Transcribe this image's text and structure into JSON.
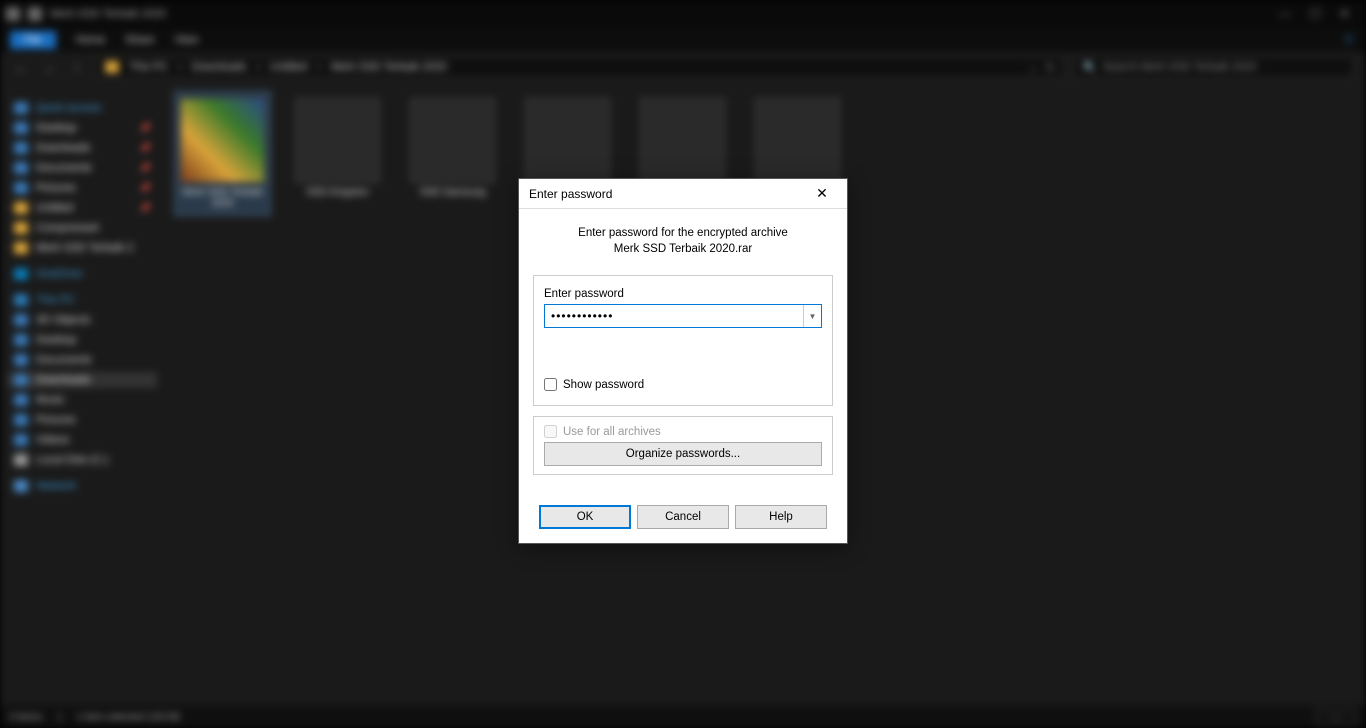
{
  "titlebar": {
    "title": "Merk SSD Terbaik 2020"
  },
  "ribbon": {
    "file": "File",
    "tabs": [
      "Home",
      "Share",
      "View"
    ]
  },
  "breadcrumb": {
    "parts": [
      "This PC",
      "Downloads",
      "Untitled",
      "Merk SSD Terbaik 2020"
    ]
  },
  "search": {
    "placeholder": "Search Merk SSD Terbaik 2020"
  },
  "sidebar": {
    "quick": "Quick access",
    "qitems": [
      "Desktop",
      "Downloads",
      "Documents",
      "Pictures",
      "Untitled",
      "Compressed",
      "Merk SSD Terbaik 2"
    ],
    "onedrive": "OneDrive",
    "thispc": "This PC",
    "pcitems": [
      "3D Objects",
      "Desktop",
      "Documents",
      "Downloads",
      "Music",
      "Pictures",
      "Videos",
      "Local Disk (C:)"
    ],
    "network": "Network"
  },
  "thumbs": [
    {
      "label": "Merk SSD Terbaik 2020"
    },
    {
      "label": "SSD Kingston"
    },
    {
      "label": "SSD Samsung"
    },
    {
      "label": ""
    },
    {
      "label": ""
    },
    {
      "label": ""
    }
  ],
  "statusbar": {
    "items": "6 items",
    "selected": "1 item selected   129 KB"
  },
  "dialog": {
    "title": "Enter password",
    "msg1": "Enter password for the encrypted archive",
    "msg2": "Merk SSD Terbaik 2020.rar",
    "input_label": "Enter password",
    "password_value": "••••••••••••",
    "show_pw": "Show password",
    "use_all": "Use for all archives",
    "organize": "Organize passwords...",
    "ok": "OK",
    "cancel": "Cancel",
    "help": "Help"
  }
}
